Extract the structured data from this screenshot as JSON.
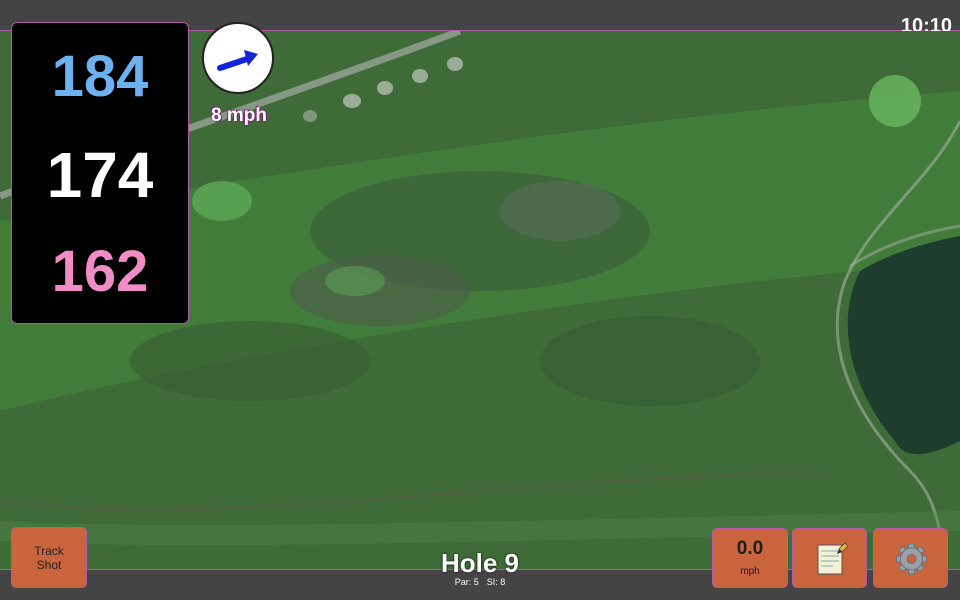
{
  "status_bar": {
    "time": "10:10"
  },
  "yardage": {
    "back": "184",
    "middle": "174",
    "front": "162"
  },
  "wind": {
    "speed": "8 mph",
    "direction_icon": "arrow-right-up-icon"
  },
  "track_button": {
    "label_line1": "Track",
    "label_line2": "Shot"
  },
  "hole": {
    "title": "Hole 9",
    "par": "Par: 5",
    "stroke_index": "SI: 8"
  },
  "speed_button": {
    "value": "0.0",
    "unit": "mph"
  },
  "notes_button": {
    "icon": "notepad-icon"
  },
  "settings_button": {
    "icon": "gear-icon"
  },
  "colors": {
    "accent": "#b05aa8",
    "button": "#c9643c",
    "back": "#6fb0ee",
    "front": "#f28cc6"
  }
}
